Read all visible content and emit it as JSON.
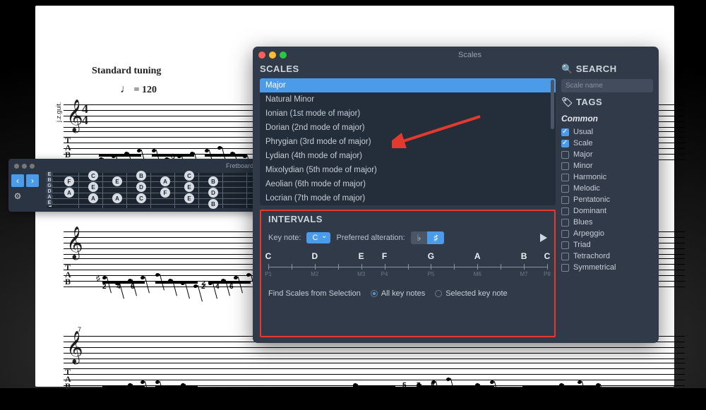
{
  "sheet": {
    "tuning_label": "Standard tuning",
    "tempo": "= 120",
    "instrument_side_label": "j.z.guit.",
    "clef": "𝄞",
    "time_top": "4",
    "time_bot": "4",
    "tab_letters": "T\nA\nB",
    "tab_row_numbers": [
      "2",
      "4",
      "6",
      "2",
      "4",
      "6"
    ],
    "tab_row2_numbers": [
      "5",
      "7",
      "8"
    ],
    "bar_number_7": "7"
  },
  "fretboard": {
    "title": "Fretboard",
    "nav_prev": "‹",
    "nav_next": "›",
    "gear": "⚙",
    "open_notes": [
      "E",
      "B",
      "G",
      "D",
      "A",
      "E"
    ],
    "marks": [
      "F",
      "A",
      "C",
      "E",
      "E",
      "A",
      "D",
      "B",
      "F",
      "A",
      "C",
      "E",
      "B",
      "D",
      "A",
      "C",
      "E",
      "B"
    ]
  },
  "dialog": {
    "window_title": "Scales",
    "scales_header": "SCALES",
    "scales": [
      "Major",
      "Natural Minor",
      "Ionian (1st mode of major)",
      "Dorian (2nd mode of major)",
      "Phrygian (3rd mode of major)",
      "Lydian (4th mode of major)",
      "Mixolydian (5th mode of major)",
      "Aeolian (6th mode of major)",
      "Locrian (7th mode of major)"
    ],
    "selected_scale_index": 0,
    "intervals_header": "INTERVALS",
    "key_note_label": "Key note:",
    "key_note_value": "C",
    "pref_alt_label": "Preferred alteration:",
    "alt_flat": "♭",
    "alt_sharp": "♯",
    "alt_selected": "sharp",
    "notes": [
      {
        "n": "C",
        "b": "P1"
      },
      {
        "n": "D",
        "b": "M2"
      },
      {
        "n": "E",
        "b": "M3"
      },
      {
        "n": "F",
        "b": "P4"
      },
      {
        "n": "G",
        "b": "P5"
      },
      {
        "n": "A",
        "b": "M6"
      },
      {
        "n": "B",
        "b": "M7"
      },
      {
        "n": "C",
        "b": "P8"
      }
    ],
    "find_label": "Find Scales from Selection",
    "radio_all": "All key notes",
    "radio_sel": "Selected key note",
    "radio_value": "all",
    "search_header": "SEARCH",
    "search_placeholder": "Scale name",
    "tags_header": "TAGS",
    "tags_group": "Common",
    "tags": [
      {
        "label": "Usual",
        "on": true
      },
      {
        "label": "Scale",
        "on": true
      },
      {
        "label": "Major",
        "on": false
      },
      {
        "label": "Minor",
        "on": false
      },
      {
        "label": "Harmonic",
        "on": false
      },
      {
        "label": "Melodic",
        "on": false
      },
      {
        "label": "Pentatonic",
        "on": false
      },
      {
        "label": "Dominant",
        "on": false
      },
      {
        "label": "Blues",
        "on": false
      },
      {
        "label": "Arpeggio",
        "on": false
      },
      {
        "label": "Triad",
        "on": false
      },
      {
        "label": "Tetrachord",
        "on": false
      },
      {
        "label": "Symmetrical",
        "on": false
      }
    ]
  }
}
